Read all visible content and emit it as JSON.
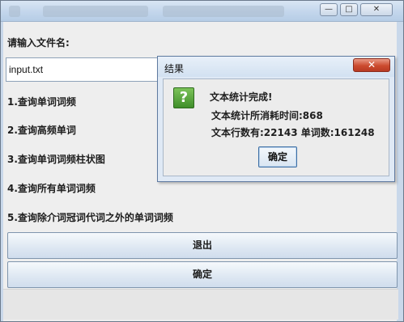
{
  "window": {
    "buttons": {
      "minimize": "—",
      "maximize": "□",
      "close": "✕"
    }
  },
  "main": {
    "prompt_label": "请输入文件名:",
    "file_input_value": "input.txt",
    "options": [
      "1.查询单词词频",
      "2.查询高频单词",
      "3.查询单词词频柱状图",
      "4.查询所有单词词频",
      "5.查询除介词冠词代词之外的单词词频"
    ],
    "exit_button": "退出",
    "confirm_button": "确定"
  },
  "dialog": {
    "title": "结果",
    "close_glyph": "✕",
    "icon_glyph": "?",
    "message_title": "文本统计完成!",
    "line_time": "文本统计所消耗时间:868",
    "line_counts": "文本行数有:22143 单词数:161248",
    "ok_button": "确定"
  },
  "colors": {
    "background": "#eeeeee",
    "titlebar": "#c3d6ec",
    "dialog_close": "#cc4b2f",
    "icon_green": "#3f8e2a"
  },
  "icons": {
    "minimize": "minimize-icon",
    "maximize": "maximize-icon",
    "close": "close-icon",
    "question": "question-icon"
  }
}
